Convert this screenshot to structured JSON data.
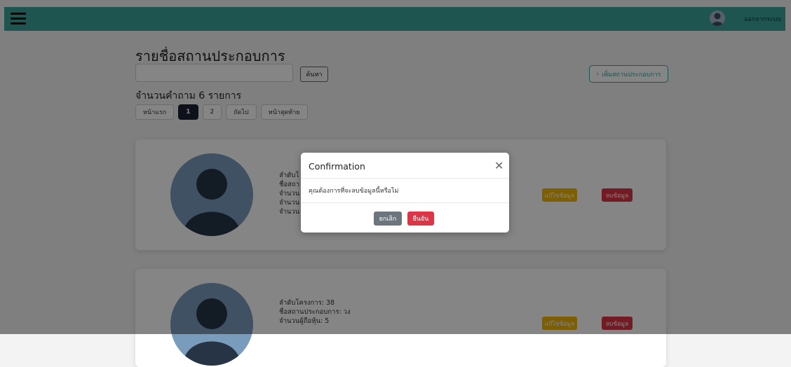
{
  "header": {
    "menu_icon": "hamburger-icon",
    "user_icon": "user-avatar-icon",
    "logout_label": "ออกจากระบบ"
  },
  "main": {
    "title": "รายชื่อสถานประกอบการ",
    "search": {
      "value": "",
      "placeholder": ""
    },
    "search_button_label": "ค้นหา",
    "add_button_label": "เพิ่มสถานประกอบการ",
    "count_label": "จำนวนคำถาม 6 รายการ",
    "pagination": {
      "first": "หน้าแรก",
      "pages": [
        "1",
        "2"
      ],
      "active_page": "1",
      "next": "ถัดไป",
      "last": "หน้าสุดท้าย"
    },
    "cards": [
      {
        "lines": [
          "ลำดับโ",
          "ชื่อสถา",
          "จำนวน",
          "จำนวน",
          "จำนวน"
        ],
        "edit_label": "แก้ไขข้อมูล",
        "delete_label": "ลบข้อมูล"
      },
      {
        "lines": [
          "ลำดับโครงการ: 38",
          "ชื่อสถานประกอบการ: วง",
          "จำนวนผู้ถือหุ้น: 5"
        ],
        "edit_label": "แก้ไขข้อมูล",
        "delete_label": "ลบข้อมูล"
      }
    ]
  },
  "modal": {
    "title": "Confirmation",
    "close_icon": "close-icon",
    "message": "คุณต้องการที่จะลบข้อมูลนี้หรือไม่",
    "cancel_label": "ยกเลิก",
    "confirm_label": "ยืนยัน"
  },
  "colors": {
    "topbar": "#3aa39a",
    "edit": "#f0b400",
    "delete": "#dc3545",
    "cancel": "#6c757d",
    "active_page": "#1b2233"
  }
}
